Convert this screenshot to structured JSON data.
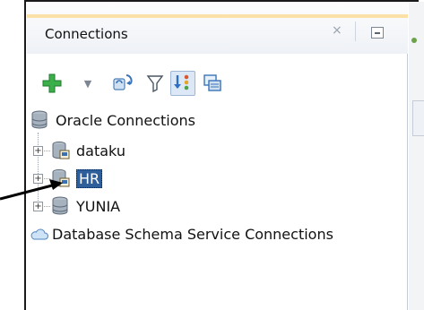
{
  "panel": {
    "title": "Connections",
    "close_symbol": "×"
  },
  "toolbar": {
    "add_icon": "plus-icon",
    "dropdown_symbol": "▼",
    "refresh_icon": "refresh-icon",
    "filter_icon": "filter-icon",
    "sync_icon": "sync-icon",
    "copy_icon": "copy-icon"
  },
  "tree": {
    "root_label": "Oracle Connections",
    "connections": [
      {
        "label": "dataku",
        "selected": false
      },
      {
        "label": "HR",
        "selected": true
      },
      {
        "label": "YUNIA",
        "selected": false
      }
    ],
    "schema_service_label": "Database Schema Service Connections"
  },
  "colors": {
    "accent": "#fbe1a8",
    "selection": "#2f5f9a",
    "database": "#8a97a6",
    "add": "#3bb04a"
  }
}
